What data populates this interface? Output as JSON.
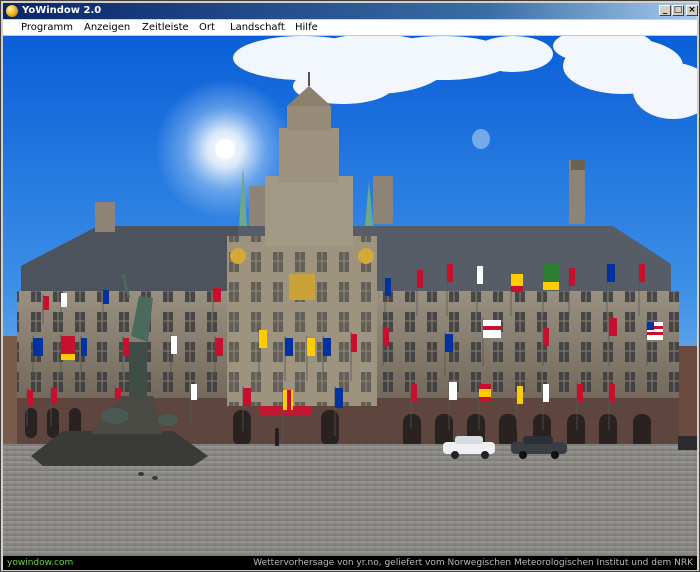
{
  "window": {
    "title": "YoWindow 2.0",
    "controls": {
      "minimize": "_",
      "maximize": "□",
      "close": "×"
    }
  },
  "menu": {
    "items": [
      {
        "label": "Programm"
      },
      {
        "label": "Anzeigen"
      },
      {
        "label": "Zeitleiste"
      },
      {
        "label": "Ort"
      },
      {
        "label": "Landschaft"
      },
      {
        "label": "Hilfe"
      }
    ]
  },
  "scene": {
    "sky_top": "#0a5fd8",
    "sky_bottom": "#7ab6ef",
    "building_roof": "#5a6068",
    "building_wall": "#8a8070",
    "plaza": "#8a8a86",
    "flag_colors": [
      "#c8102e",
      "#ffffff",
      "#0033a0",
      "#ffcc00",
      "#2e7d32"
    ]
  },
  "status": {
    "left": "yowindow.com",
    "right": "Wettervorhersage von yr.no, geliefert vom Norwegischen Meteorologischen Institut und dem NRK"
  }
}
